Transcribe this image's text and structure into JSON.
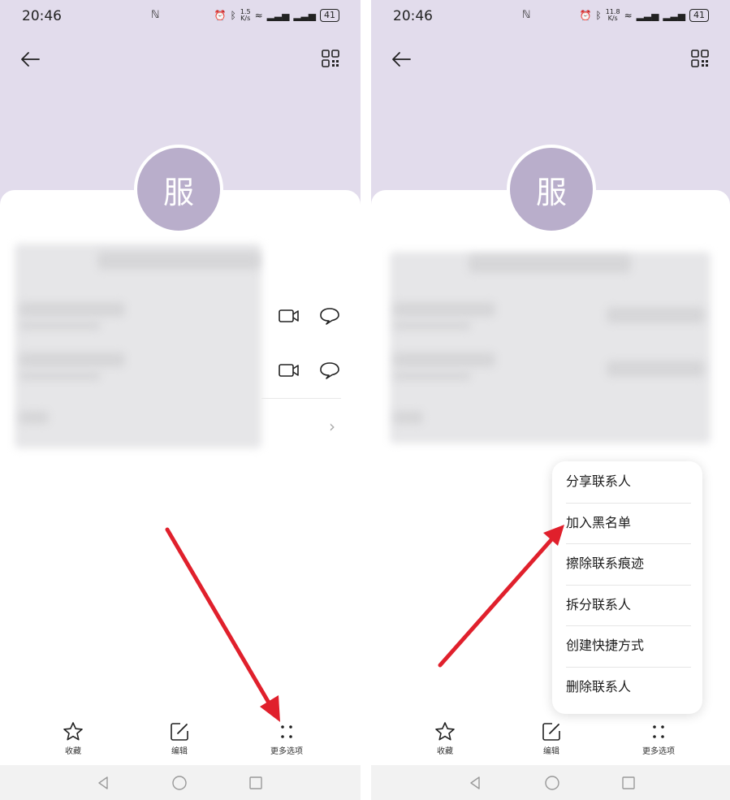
{
  "status": {
    "time": "20:46",
    "battery": "41",
    "nfc": "N"
  },
  "left": {
    "speed_top": "1.5",
    "speed_bottom": "K/s"
  },
  "right": {
    "speed_top": "11.8",
    "speed_bottom": "K/s"
  },
  "avatar": {
    "initial": "服"
  },
  "bottom_bar": {
    "favorite": "收藏",
    "edit": "编辑",
    "more": "更多选项"
  },
  "menu": {
    "items": [
      "分享联系人",
      "加入黑名单",
      "擦除联系痕迹",
      "拆分联系人",
      "创建快捷方式",
      "删除联系人"
    ]
  },
  "colors": {
    "header": "#e2dcec",
    "avatar": "#b9aecb",
    "arrow": "#e0202c"
  }
}
